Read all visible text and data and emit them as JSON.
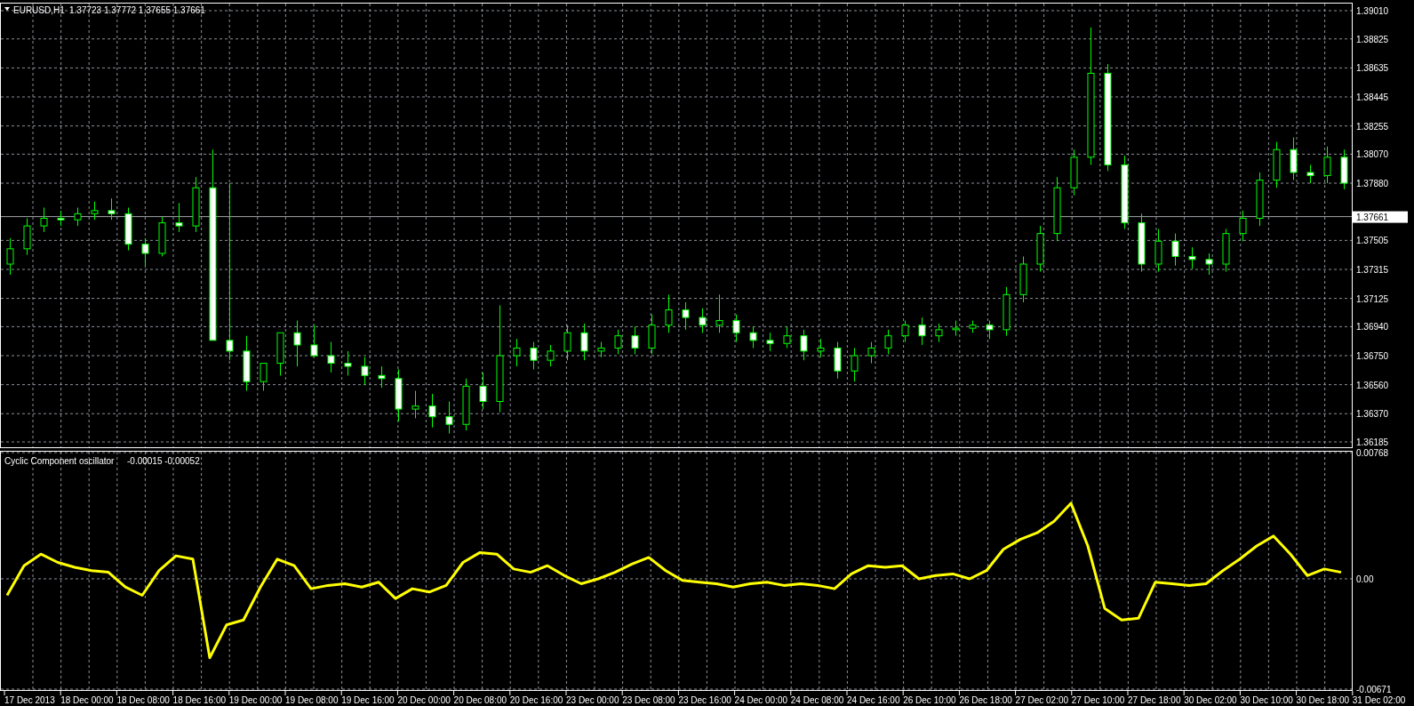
{
  "price_panel": {
    "symbol": "EURUSD,H1",
    "quote": "1.37723 1.37772 1.37655 1.37661",
    "current_price": "1.37661",
    "price_axis": [
      "1.39010",
      "1.38825",
      "1.38635",
      "1.38445",
      "1.38255",
      "1.38070",
      "1.37880",
      "1.37505",
      "1.37315",
      "1.37125",
      "1.36940",
      "1.36750",
      "1.36560",
      "1.36370",
      "1.36185"
    ]
  },
  "indicator_panel": {
    "readings": "-0.00015 -0.00052",
    "chart_data": {
      "type": "line",
      "ylim": [
        -0.00671,
        0.00768
      ],
      "yticks": [
        {
          "value": 0.00768,
          "label": "0.00768"
        },
        {
          "value": 0,
          "label": "0.00"
        },
        {
          "value": -0.00671,
          "label": "-0.00671"
        }
      ],
      "series": [
        {
          "name": "Cyclic Component oscillator",
          "color": "#ffff00",
          "values": [
            -0.001,
            0.0008,
            0.0015,
            0.001,
            0.0007,
            0.0005,
            0.0004,
            -0.0005,
            -0.001,
            0.0005,
            0.0014,
            0.0012,
            -0.0048,
            -0.0028,
            -0.0025,
            -0.0005,
            0.0012,
            0.0008,
            -0.0006,
            -0.0004,
            -0.0003,
            -0.0005,
            -0.0002,
            -0.0012,
            -0.0006,
            -0.0008,
            -0.0004,
            0.001,
            0.0016,
            0.0015,
            0.0006,
            0.0004,
            0.0008,
            0.0002,
            -0.0003,
            0,
            0.0004,
            0.0009,
            0.0013,
            0.0005,
            -0.0001,
            -0.0002,
            -0.0003,
            -0.0005,
            -0.0003,
            -0.0002,
            -0.0004,
            -0.0003,
            -0.0004,
            -0.0006,
            0.0003,
            0.0008,
            0.0007,
            0.0008,
            0,
            0.0002,
            0.0003,
            0,
            0.0005,
            0.0018,
            0.0024,
            0.0028,
            0.0035,
            0.0046,
            0.002,
            -0.0018,
            -0.0025,
            -0.0024,
            -0.0002,
            -0.0003,
            -0.0004,
            -0.0003,
            0.0005,
            0.0012,
            0.002,
            0.0026,
            0.0015,
            0.0002,
            0.0006,
            0.0004
          ]
        }
      ]
    }
  },
  "time_axis": [
    "17 Dec 2013",
    "18 Dec 00:00",
    "18 Dec 08:00",
    "18 Dec 16:00",
    "19 Dec 00:00",
    "19 Dec 08:00",
    "19 Dec 16:00",
    "20 Dec 00:00",
    "20 Dec 08:00",
    "20 Dec 16:00",
    "23 Dec 00:00",
    "23 Dec 08:00",
    "23 Dec 16:00",
    "24 Dec 00:00",
    "24 Dec 08:00",
    "24 Dec 16:00",
    "26 Dec 10:00",
    "26 Dec 18:00",
    "27 Dec 02:00",
    "27 Dec 10:00",
    "27 Dec 18:00",
    "30 Dec 02:00",
    "30 Dec 10:00",
    "30 Dec 18:00",
    "31 Dec 02:00"
  ]
}
